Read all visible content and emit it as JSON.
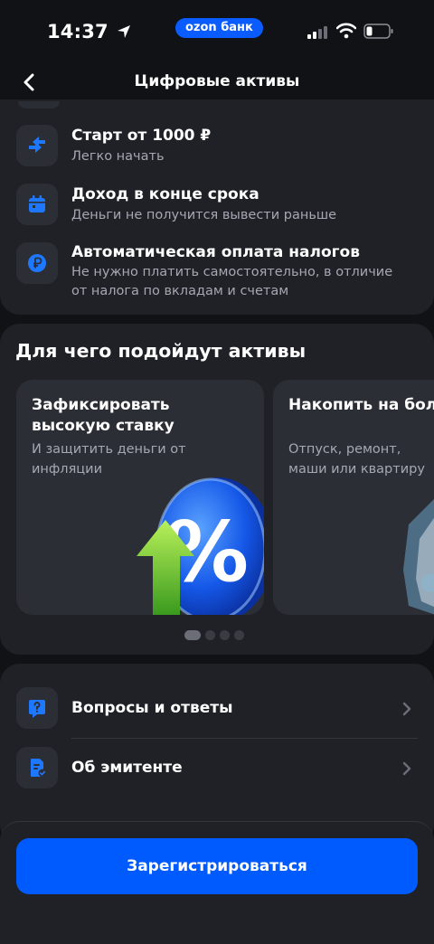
{
  "status_bar": {
    "time": "14:37",
    "app_pill": "ozon банк"
  },
  "nav": {
    "title": "Цифровые активы"
  },
  "features": [
    {
      "icon": "transfer-arrows-icon",
      "title": "Старт от 1000 ₽",
      "subtitle": "Легко начать"
    },
    {
      "icon": "calendar-icon",
      "title": "Доход в конце срока",
      "subtitle": "Деньги не получится вывести раньше"
    },
    {
      "icon": "ruble-coin-icon",
      "title": "Автоматическая оплата налогов",
      "subtitle": "Не нужно платить самостоятельно, в отличие от налога по вкладам и счетам"
    }
  ],
  "uses": {
    "title": "Для чего подойдут активы",
    "cards": [
      {
        "title": "Зафиксировать высокую ставку",
        "subtitle": "И защитить деньги от инфляции",
        "illustration": "percent-coin-illustration"
      },
      {
        "title": "Накопить на больш",
        "subtitle": "Отпуск, ремонт, маши или квартиру",
        "illustration": "shield-lock-illustration"
      }
    ],
    "carousel": {
      "count": 4,
      "active": 1
    }
  },
  "links": [
    {
      "icon": "question-icon",
      "label": "Вопросы и ответы"
    },
    {
      "icon": "document-check-icon",
      "label": "Об эмитенте"
    }
  ],
  "cta": {
    "label": "Зарегистрироваться"
  },
  "colors": {
    "accent": "#005bff",
    "background": "#111216",
    "card": "#202127",
    "tile": "#2c2e35",
    "secondary_text": "#a5a8b2"
  }
}
